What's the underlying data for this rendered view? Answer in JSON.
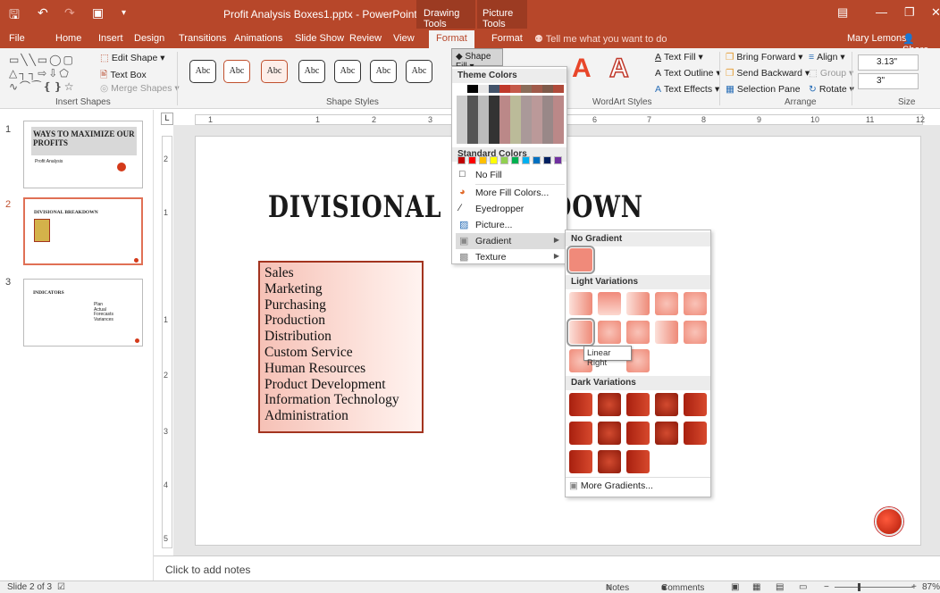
{
  "window": {
    "title": "Profit Analysis Boxes1.pptx - PowerPoint",
    "context_tabs": [
      "Drawing Tools",
      "Picture Tools"
    ],
    "user": "Mary Lemons",
    "share": "Share"
  },
  "tabs": [
    "File",
    "Home",
    "Insert",
    "Design",
    "Transitions",
    "Animations",
    "Slide Show",
    "Review",
    "View",
    "Format",
    "Format"
  ],
  "active_tab": "Format",
  "tell_me": "Tell me what you want to do",
  "ribbon": {
    "insert_shapes": {
      "label": "Insert Shapes",
      "edit_shape": "Edit Shape",
      "text_box": "Text Box",
      "merge_shapes": "Merge Shapes"
    },
    "shape_styles": {
      "label": "Shape Styles",
      "style_sample": "Abc",
      "shape_fill": "Shape Fill"
    },
    "wordart": {
      "label": "WordArt Styles",
      "text_fill": "Text Fill",
      "text_outline": "Text Outline",
      "text_effects": "Text Effects"
    },
    "arrange": {
      "label": "Arrange",
      "bring_forward": "Bring Forward",
      "send_backward": "Send Backward",
      "selection_pane": "Selection Pane",
      "align": "Align",
      "group": "Group",
      "rotate": "Rotate"
    },
    "size": {
      "label": "Size",
      "height": "3.13\"",
      "width": "3\""
    }
  },
  "ruler": {
    "h_ticks": [
      "1",
      "1",
      "2",
      "3",
      "6",
      "7",
      "8",
      "9",
      "10",
      "11",
      "12"
    ],
    "v_ticks": [
      "2",
      "1",
      "1",
      "2",
      "3",
      "4",
      "5"
    ]
  },
  "thumbnails": [
    {
      "num": "1",
      "title": "WAYS TO MAXIMIZE OUR PROFITS",
      "sub": "Profit Analysis"
    },
    {
      "num": "2",
      "title": "DIVISIONAL BREAKDOWN"
    },
    {
      "num": "3",
      "title": "INDICATORS",
      "bullets": [
        "Plan",
        "Actual",
        "Forecasts",
        "Variances"
      ]
    }
  ],
  "slide": {
    "title": "DIVISIONAL BREAKDOWN",
    "divisions": [
      "Sales",
      "Marketing",
      "Purchasing",
      "Production",
      "Distribution",
      "Custom Service",
      "Human Resources",
      "Product Development",
      "Information Technology",
      "Administration"
    ]
  },
  "shape_fill_menu": {
    "theme_colors": "Theme Colors",
    "standard_colors": "Standard Colors",
    "standard_swatches": [
      "#c00000",
      "#ff0000",
      "#ffc000",
      "#ffff00",
      "#92d050",
      "#00b050",
      "#00b0f0",
      "#0070c0",
      "#002060",
      "#7030a0"
    ],
    "no_fill": "No Fill",
    "more_fill_colors": "More Fill Colors...",
    "eyedropper": "Eyedropper",
    "picture": "Picture...",
    "gradient": "Gradient",
    "texture": "Texture"
  },
  "gradient_menu": {
    "no_gradient": "No Gradient",
    "light_variations": "Light Variations",
    "dark_variations": "Dark Variations",
    "tooltip": "Linear Right",
    "more_gradients": "More Gradients..."
  },
  "notes_placeholder": "Click to add notes",
  "status": {
    "slide": "Slide 2 of 3",
    "notes": "Notes",
    "comments": "Comments",
    "zoom": "87%"
  }
}
